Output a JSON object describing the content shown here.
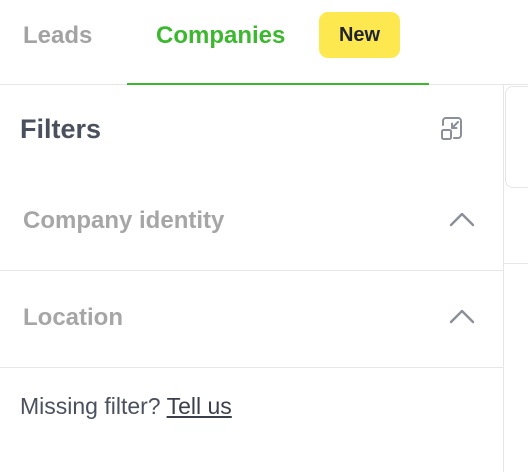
{
  "tabs": {
    "leads": {
      "label": "Leads"
    },
    "companies": {
      "label": "Companies",
      "badge": "New"
    }
  },
  "filters": {
    "title": "Filters",
    "collapse_icon": "collapse-arrows-icon",
    "sections": [
      {
        "label": "Company identity",
        "icon": "chevron-up-icon"
      },
      {
        "label": "Location",
        "icon": "chevron-up-icon"
      }
    ],
    "missing": {
      "text": "Missing filter?",
      "link": "Tell us"
    }
  },
  "colors": {
    "accent": "#3cb82f",
    "badge": "#fde94f",
    "muted": "#a6a6a6",
    "text": "#4a505e"
  }
}
